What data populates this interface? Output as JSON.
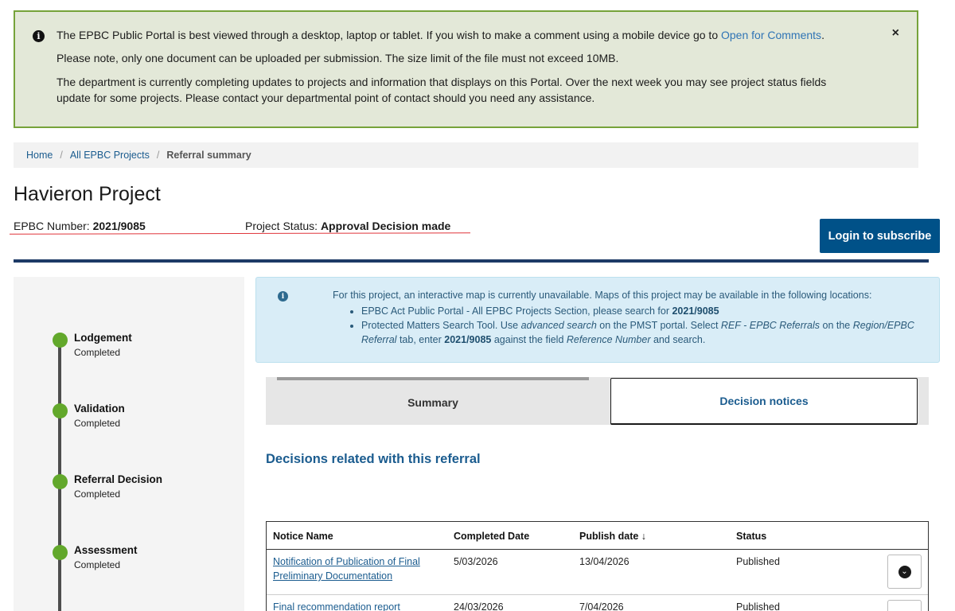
{
  "alert": {
    "line1_text": "The EPBC Public Portal is best viewed through a desktop, laptop or tablet.  If you wish to make a comment using a mobile device go to",
    "line1_link": "Open for Comments",
    "line1_end": ".",
    "line2": "Please note, only one document can be uploaded per submission. The size limit of the file must not exceed 10MB.",
    "line3": "The department is currently completing updates to projects and information that displays on this Portal. Over the next week you may see project status fields update for some projects. Please contact your departmental point of contact should you need any assistance.",
    "close": "×"
  },
  "breadcrumb": {
    "home": "Home",
    "projects": "All EPBC Projects",
    "current": "Referral summary",
    "separator": "/"
  },
  "project": {
    "title": "Havieron Project",
    "epbc_label": "EPBC Number:",
    "epbc_number": "2021/9085",
    "status_label": "Project Status:",
    "status_value": "Approval Decision made"
  },
  "subscribe_button": "Login to subscribe",
  "timeline": [
    {
      "name": "Lodgement",
      "state": "Completed"
    },
    {
      "name": "Validation",
      "state": "Completed"
    },
    {
      "name": "Referral Decision",
      "state": "Completed"
    },
    {
      "name": "Assessment",
      "state": "Completed"
    }
  ],
  "info_box": {
    "intro": "For this project, an interactive map is currently unavailable. Maps of this project may be available in the following locations:",
    "bullet1_text": "EPBC Act Public Portal - All EPBC Projects Section, please search for",
    "bullet1_bold": "2021/9085",
    "bullet2_a": "Protected Matters Search Tool. Use",
    "bullet2_i1": "advanced search",
    "bullet2_b": "on the PMST portal. Select",
    "bullet2_i2": "REF - EPBC Referrals",
    "bullet2_c": "on the",
    "bullet2_i3": "Region/EPBC Referral",
    "bullet2_d": "tab, enter",
    "bullet2_bold": "2021/9085",
    "bullet2_e": "against the field",
    "bullet2_i4": "Reference Number",
    "bullet2_f": "and search."
  },
  "tabs": {
    "summary": "Summary",
    "decision_notices": "Decision notices"
  },
  "section_title": "Decisions related with this referral",
  "table": {
    "headers": [
      "Notice Name",
      "Completed Date",
      "Publish date ↓",
      "Status"
    ],
    "rows": [
      {
        "name": "Notification of Publication of Final Preliminary Documentation",
        "completed": "5/03/2026",
        "published": "13/04/2026",
        "status": "Published"
      },
      {
        "name": "Final recommendation report",
        "completed": "24/03/2026",
        "published": "7/04/2026",
        "status": "Published"
      }
    ]
  },
  "icons": {
    "info": "info-circle-icon",
    "close": "close-icon",
    "expand": "chevron-down-circle-icon"
  },
  "colors": {
    "alert_bg": "#e3e8d8",
    "alert_border": "#76a33a",
    "primary": "#005188",
    "link": "#1b5c8f",
    "step_complete": "#62a82b",
    "info_bg": "#d9edf7"
  }
}
